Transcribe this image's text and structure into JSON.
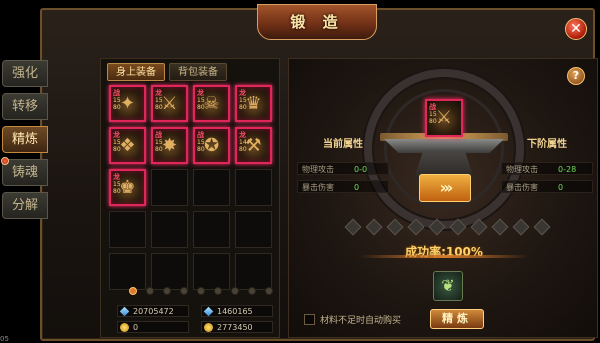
{
  "window": {
    "title": "锻 造"
  },
  "side_tabs": [
    {
      "label": "强化",
      "active": false,
      "alert": false
    },
    {
      "label": "转移",
      "active": false,
      "alert": false
    },
    {
      "label": "精炼",
      "active": true,
      "alert": false
    },
    {
      "label": "铸魂",
      "active": false,
      "alert": true
    },
    {
      "label": "分解",
      "active": false,
      "alert": false
    }
  ],
  "bag_tabs": [
    {
      "label": "身上装备",
      "active": true
    },
    {
      "label": "背包装备",
      "active": false
    }
  ],
  "items": [
    {
      "tag": "战",
      "lvl": "15\n80",
      "glyph": "✦"
    },
    {
      "tag": "龙",
      "lvl": "15\n80",
      "glyph": "⚔"
    },
    {
      "tag": "龙",
      "lvl": "15\n80",
      "glyph": "☠"
    },
    {
      "tag": "龙",
      "lvl": "15\n80",
      "glyph": "♛"
    },
    {
      "tag": "龙",
      "lvl": "15\n80",
      "glyph": "❖"
    },
    {
      "tag": "战",
      "lvl": "15\n80",
      "glyph": "✸"
    },
    {
      "tag": "战",
      "lvl": "15\n80",
      "glyph": "✪"
    },
    {
      "tag": "龙",
      "lvl": "14\n80",
      "glyph": "⚒"
    },
    {
      "tag": "龙",
      "lvl": "15\n80",
      "glyph": "♚"
    }
  ],
  "pager": {
    "count": 9,
    "active": 0
  },
  "currency": {
    "diamond_1": "20705472",
    "diamond_2": "1460165",
    "gold_1": "0",
    "gold_2": "2773450"
  },
  "forge": {
    "item_tag": "战",
    "item_lvl": "15\n80",
    "item_glyph": "⚔",
    "current_title": "当前属性",
    "next_title": "下阶属性",
    "current_attrs": [
      {
        "name": "物理攻击",
        "value": "0-0"
      },
      {
        "name": "暴击伤害",
        "value": "0"
      }
    ],
    "next_attrs": [
      {
        "name": "物理攻击",
        "value": "0-28"
      },
      {
        "name": "暴击伤害",
        "value": "0"
      }
    ],
    "arrows": "›››",
    "stars": 10,
    "success_rate": "成功率:100%",
    "material_glyph": "❦",
    "autobuy_label": "材料不足时自动购买",
    "button_label": "精炼"
  },
  "corner": "05",
  "colors": {
    "accent": "#e0275a",
    "gold": "#ffd26a",
    "green": "#6fdc5a"
  }
}
